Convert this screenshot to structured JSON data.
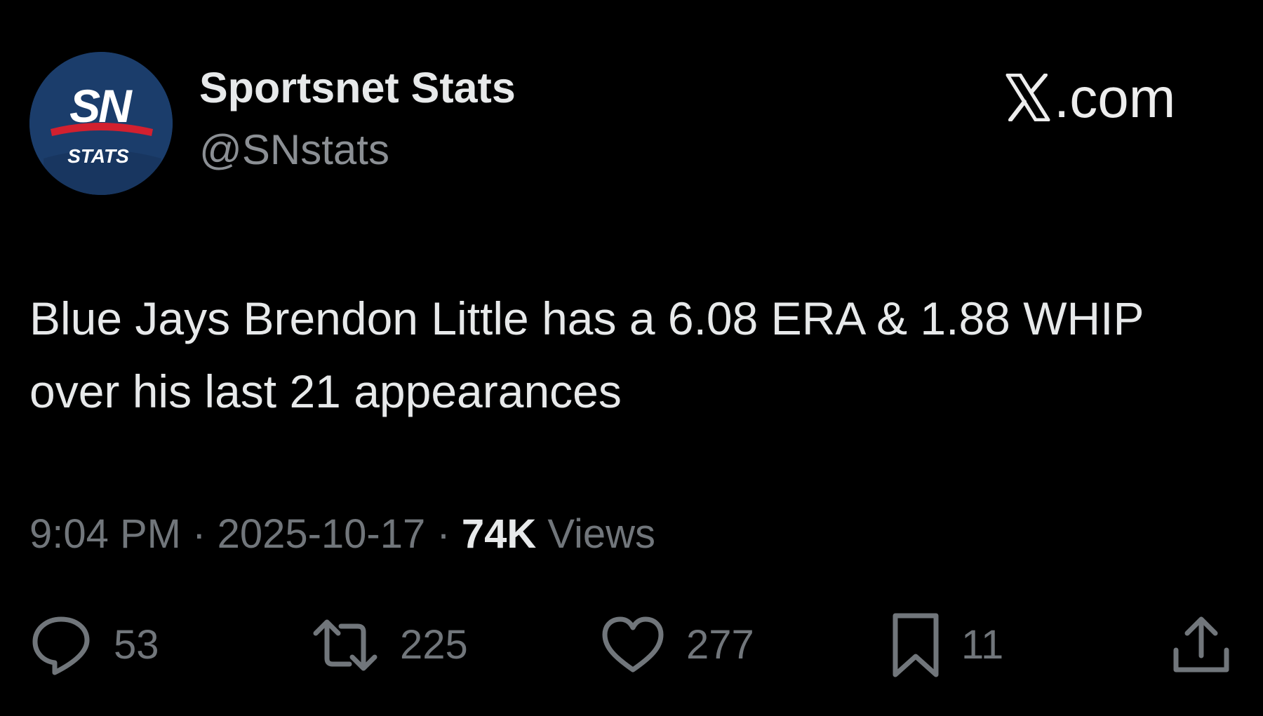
{
  "author": {
    "display_name": "Sportsnet Stats",
    "handle": "@SNstats",
    "avatar": {
      "logo_text": "SN",
      "sub_text": "STATS",
      "background_color": "#1b3d6b",
      "accent_color": "#d2202f"
    }
  },
  "brand": {
    "text": ".com",
    "icon": "x-logo-icon"
  },
  "tweet": {
    "text": "Blue Jays Brendon Little has a 6.08 ERA & 1.88 WHIP over his last 21 appearances"
  },
  "meta": {
    "time": "9:04 PM",
    "separator": "·",
    "date": "2025-10-17",
    "views_count": "74K",
    "views_label": "Views"
  },
  "actions": {
    "reply": {
      "icon": "reply-icon",
      "count": "53"
    },
    "retweet": {
      "icon": "retweet-icon",
      "count": "225"
    },
    "like": {
      "icon": "heart-icon",
      "count": "277"
    },
    "bookmark": {
      "icon": "bookmark-icon",
      "count": "11"
    },
    "share": {
      "icon": "share-icon"
    }
  },
  "colors": {
    "background": "#000000",
    "primary_text": "#e7e9ea",
    "secondary_text": "#71767b"
  }
}
